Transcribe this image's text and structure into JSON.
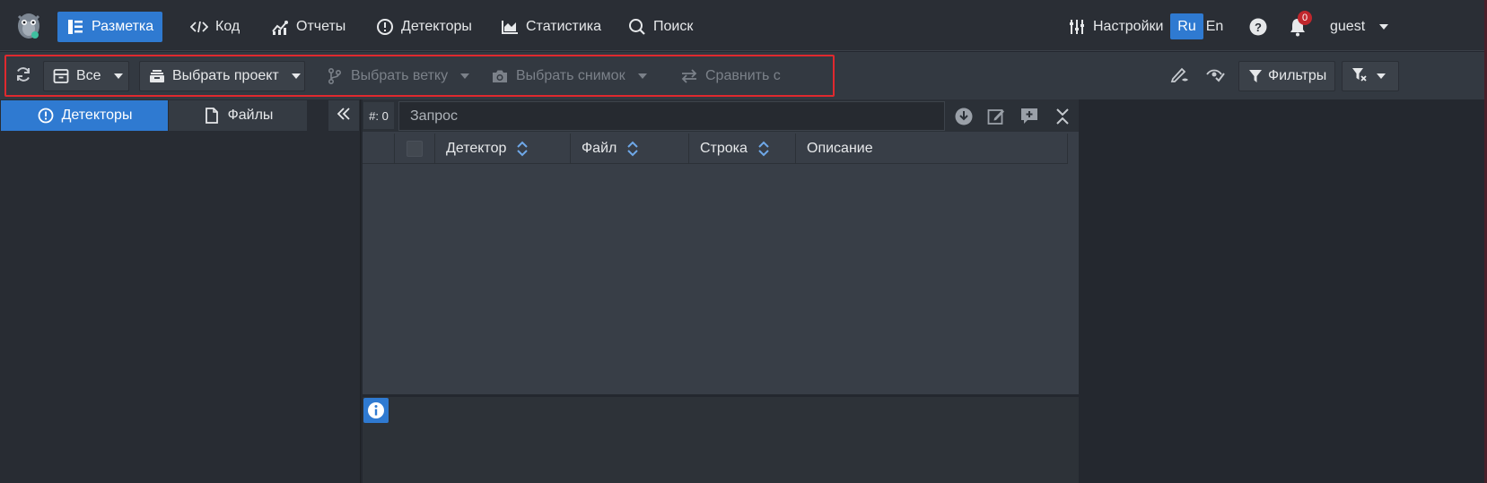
{
  "nav": {
    "items": [
      {
        "label": "Разметка",
        "icon": "layout-icon",
        "active": true
      },
      {
        "label": "Код",
        "icon": "code-icon"
      },
      {
        "label": "Отчеты",
        "icon": "chart-line-icon"
      },
      {
        "label": "Детекторы",
        "icon": "alert-circle-icon"
      },
      {
        "label": "Статистика",
        "icon": "area-chart-icon"
      },
      {
        "label": "Поиск",
        "icon": "search-icon"
      }
    ],
    "settings_label": "Настройки",
    "lang_ru": "Ru",
    "lang_en": "En",
    "notifications_count": "0",
    "user": "guest"
  },
  "toolbar": {
    "scope_label": "Все",
    "project_label": "Выбрать проект",
    "branch_label": "Выбрать ветку",
    "snapshot_label": "Выбрать снимок",
    "compare_label": "Сравнить с",
    "filters_label": "Фильтры"
  },
  "left_tabs": {
    "detectors": "Детекторы",
    "files": "Файлы"
  },
  "query": {
    "count": "#: 0",
    "placeholder": "Запрос"
  },
  "table": {
    "columns": [
      "Детектор",
      "Файл",
      "Строка",
      "Описание"
    ]
  },
  "colors": {
    "accent": "#2f7ad1",
    "highlight": "#e0292e",
    "badge": "#c0272d"
  }
}
